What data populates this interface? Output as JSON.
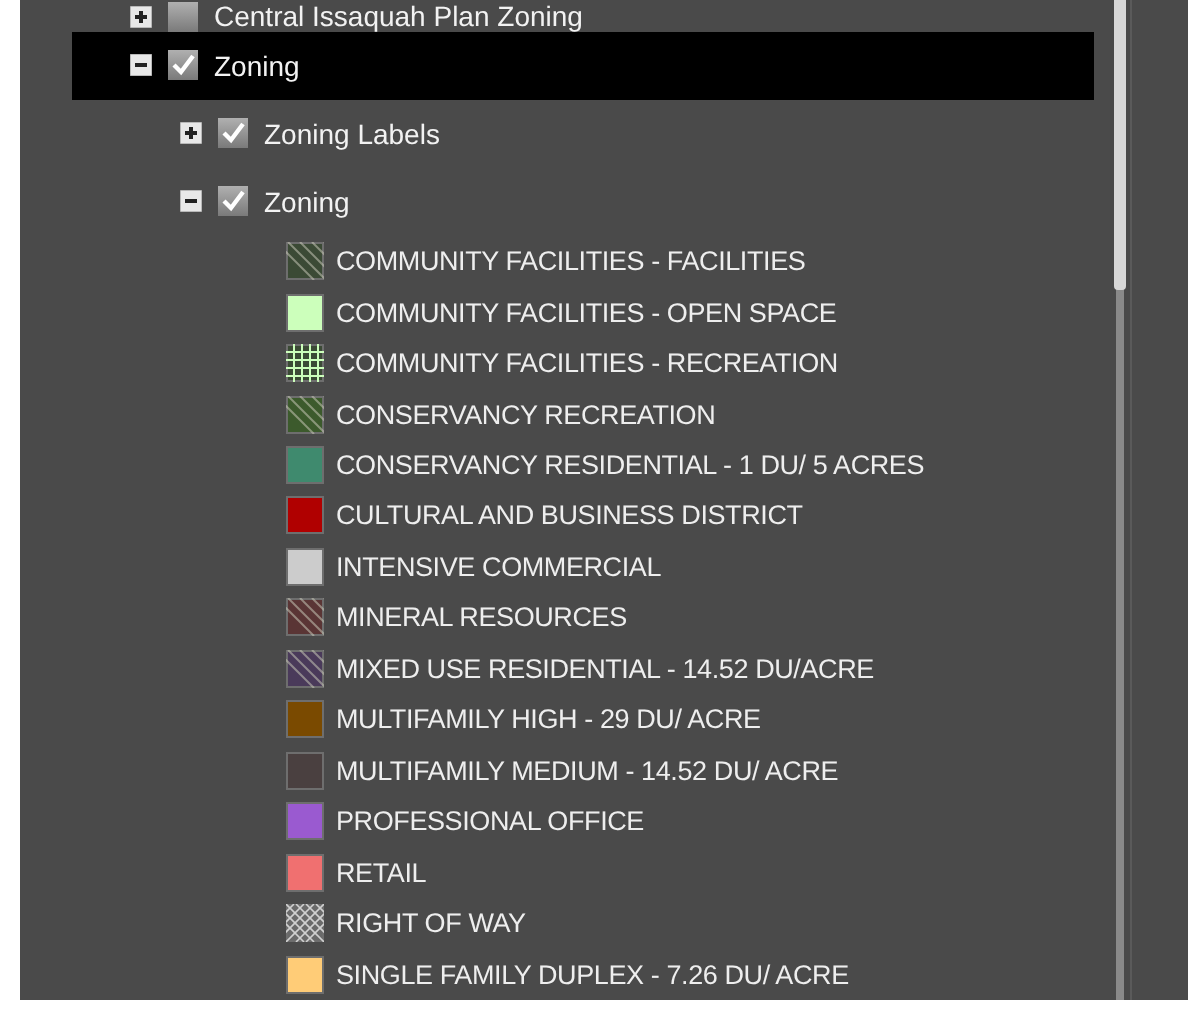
{
  "tree": [
    {
      "label": "Central Issaquah Plan Zoning",
      "expanded": false,
      "checked": false,
      "selected": false
    },
    {
      "label": "Zoning",
      "expanded": true,
      "checked": true,
      "selected": true,
      "children": [
        {
          "label": "Zoning Labels",
          "expanded": false,
          "checked": true,
          "selected": false
        },
        {
          "label": "Zoning",
          "expanded": true,
          "checked": true,
          "selected": false,
          "legend": [
            {
              "label": "COMMUNITY FACILITIES - FACILITIES",
              "kind": "hatch",
              "color": "#3b4a35"
            },
            {
              "label": "COMMUNITY FACILITIES - OPEN SPACE",
              "kind": "solid",
              "color": "#ccffbb"
            },
            {
              "label": "COMMUNITY FACILITIES - RECREATION",
              "kind": "grid",
              "color": "#3b4a35"
            },
            {
              "label": "CONSERVANCY RECREATION",
              "kind": "hatch",
              "color": "#3c5a2c"
            },
            {
              "label": "CONSERVANCY RESIDENTIAL - 1 DU/ 5 ACRES",
              "kind": "solid",
              "color": "#3f8a6e"
            },
            {
              "label": "CULTURAL AND BUSINESS DISTRICT",
              "kind": "solid",
              "color": "#b00000"
            },
            {
              "label": "INTENSIVE COMMERCIAL",
              "kind": "solid",
              "color": "#cccccc"
            },
            {
              "label": "MINERAL RESOURCES",
              "kind": "hatch",
              "color": "#5a3535"
            },
            {
              "label": "MIXED USE RESIDENTIAL - 14.52 DU/ACRE",
              "kind": "hatch",
              "color": "#4a3a5a"
            },
            {
              "label": "MULTIFAMILY HIGH - 29 DU/ ACRE",
              "kind": "solid",
              "color": "#7a4a00"
            },
            {
              "label": "MULTIFAMILY MEDIUM - 14.52 DU/ ACRE",
              "kind": "solid",
              "color": "#4a4040"
            },
            {
              "label": "PROFESSIONAL OFFICE",
              "kind": "solid",
              "color": "#9a5ad0"
            },
            {
              "label": "RETAIL",
              "kind": "solid",
              "color": "#f07070"
            },
            {
              "label": "RIGHT OF WAY",
              "kind": "crosshatch",
              "color": "#6a6a6a"
            },
            {
              "label": "SINGLE FAMILY DUPLEX - 7.26 DU/ ACRE",
              "kind": "solid",
              "color": "#ffcc77"
            }
          ]
        }
      ]
    }
  ]
}
